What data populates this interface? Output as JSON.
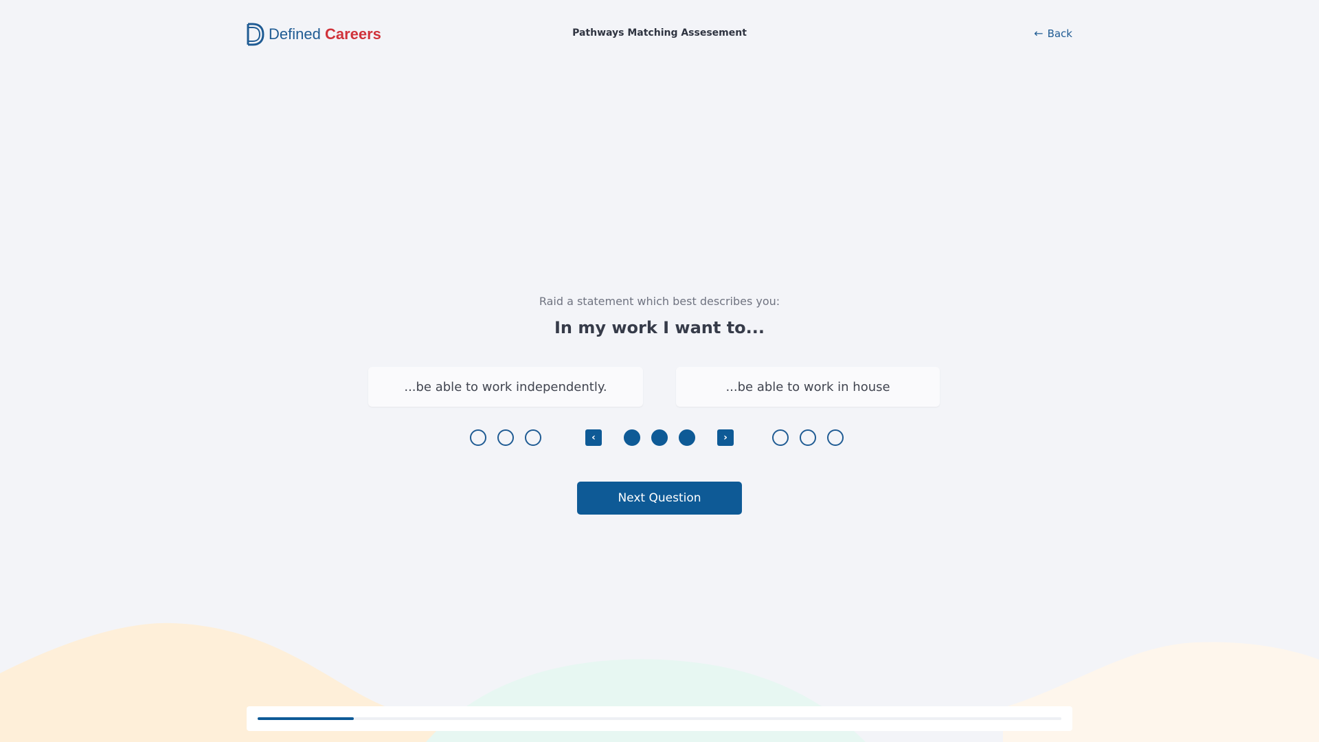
{
  "header": {
    "logo_word_1": "Defined",
    "logo_word_2": "Careers",
    "title": "Pathways Matching Assesement",
    "back_label": "Back",
    "back_icon": "arrow-left-icon"
  },
  "question": {
    "instruction": "Raid a statement which best describes you:",
    "prompt": "In my work I want to...",
    "option_left": "...be able to work independently.",
    "option_right": "...be able to work in house"
  },
  "rating": {
    "left_circles_selected": [
      false,
      false,
      false
    ],
    "center_circles_selected": [
      true,
      true,
      true
    ],
    "right_circles_selected": [
      false,
      false,
      false
    ],
    "prev_icon": "chevron-left-icon",
    "next_icon": "chevron-right-icon"
  },
  "next_button_label": "Next Question",
  "progress": {
    "fraction": 0.12
  },
  "colors": {
    "brand_blue": "#0e5a96",
    "brand_red": "#d0323a",
    "background": "#f3f4f8",
    "wave_peach": "#feefd9",
    "wave_mint": "#e7f7f2",
    "wave_cream": "#fef6ec"
  }
}
